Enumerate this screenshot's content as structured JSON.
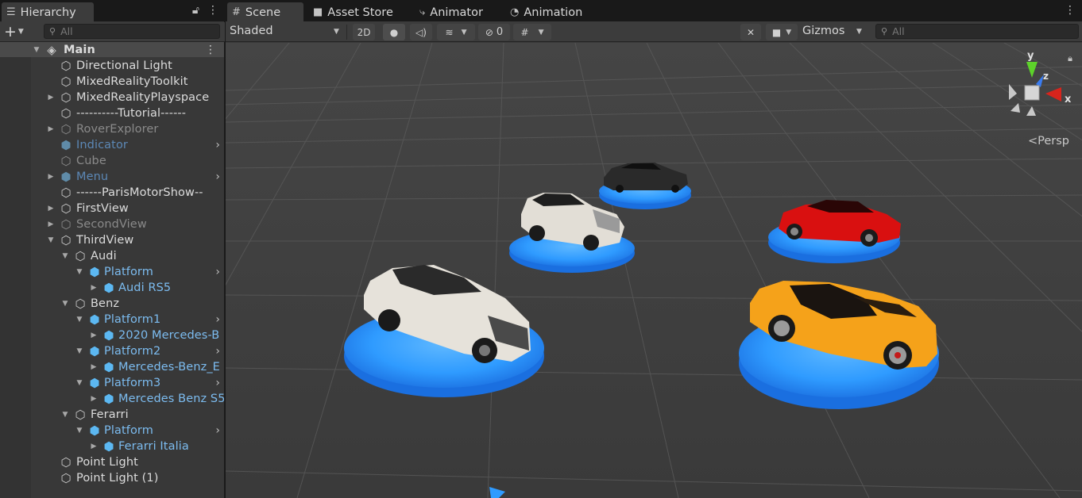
{
  "hierarchy": {
    "tab_label": "Hierarchy",
    "search_placeholder": "All",
    "scene_name": "Main",
    "items": [
      {
        "label": "Directional Light"
      },
      {
        "label": "MixedRealityToolkit"
      },
      {
        "label": "MixedRealityPlayspace"
      },
      {
        "label": "----------Tutorial------"
      },
      {
        "label": "RoverExplorer"
      },
      {
        "label": "Indicator"
      },
      {
        "label": "Cube"
      },
      {
        "label": "Menu"
      },
      {
        "label": "------ParisMotorShow--"
      },
      {
        "label": "FirstView"
      },
      {
        "label": "SecondView"
      },
      {
        "label": "ThirdView"
      },
      {
        "label": "Audi"
      },
      {
        "label": "Platform"
      },
      {
        "label": "Audi RS5"
      },
      {
        "label": "Benz"
      },
      {
        "label": "Platform1"
      },
      {
        "label": "2020 Mercedes-B"
      },
      {
        "label": "Platform2"
      },
      {
        "label": "Mercedes-Benz_E"
      },
      {
        "label": "Platform3"
      },
      {
        "label": "Mercedes Benz S5"
      },
      {
        "label": "Ferarri"
      },
      {
        "label": "Platform"
      },
      {
        "label": "Ferarri Italia"
      },
      {
        "label": "Point Light"
      },
      {
        "label": "Point Light (1)"
      }
    ]
  },
  "scene_tabs": {
    "scene": "Scene",
    "asset_store": "Asset Store",
    "animator": "Animator",
    "animation": "Animation"
  },
  "scene_toolbar": {
    "shading_mode": "Shaded",
    "mode_2d": "2D",
    "hidden_count": "0",
    "gizmos": "Gizmos",
    "search_placeholder": "All"
  },
  "viewport": {
    "projection": "Persp",
    "axis_labels": {
      "x": "x",
      "y": "y",
      "z": "z"
    }
  },
  "colors": {
    "platform_blue": "#2f9bff",
    "ferrari_orange": "#f5a21a",
    "red_car": "#d91010",
    "prefab_text": "#7cbcf0"
  }
}
